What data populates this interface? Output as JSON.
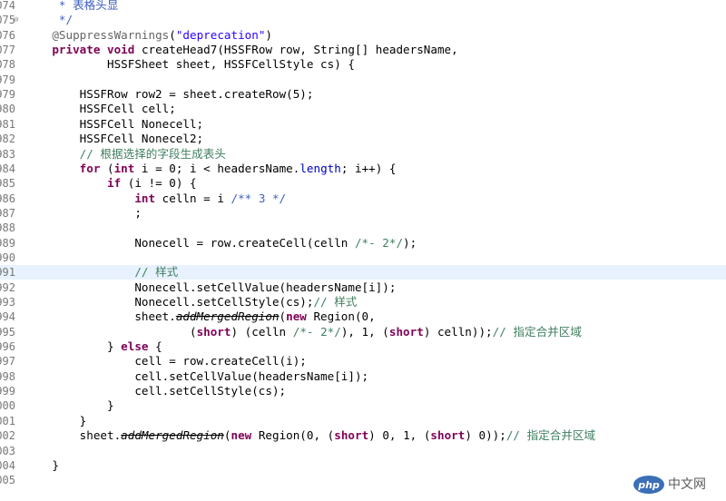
{
  "editor": {
    "current_line": "991",
    "lines": [
      {
        "num": "074",
        "tokens": [
          {
            "t": "     * ",
            "c": "jd"
          },
          {
            "t": "表格头显",
            "c": "jd"
          }
        ]
      },
      {
        "num": "075",
        "fold": "minus",
        "tokens": [
          {
            "t": "     */",
            "c": "jd"
          }
        ]
      },
      {
        "num": "076",
        "tokens": [
          {
            "t": "    ",
            "c": "plain"
          },
          {
            "t": "@SuppressWarnings",
            "c": "ann"
          },
          {
            "t": "(",
            "c": "plain"
          },
          {
            "t": "\"deprecation\"",
            "c": "str"
          },
          {
            "t": ")",
            "c": "plain"
          }
        ]
      },
      {
        "num": "077",
        "tokens": [
          {
            "t": "    ",
            "c": "plain"
          },
          {
            "t": "private",
            "c": "kw"
          },
          {
            "t": " ",
            "c": "plain"
          },
          {
            "t": "void",
            "c": "kw"
          },
          {
            "t": " createHead7(HSSFRow row, String[] headersName,",
            "c": "plain"
          }
        ]
      },
      {
        "num": "078",
        "tokens": [
          {
            "t": "            HSSFSheet sheet, HSSFCellStyle cs) {",
            "c": "plain"
          }
        ]
      },
      {
        "num": "979",
        "tokens": []
      },
      {
        "num": "979",
        "tokens": [
          {
            "t": "        HSSFRow row2 = sheet.createRow(5);",
            "c": "plain"
          }
        ]
      },
      {
        "num": "980",
        "tokens": [
          {
            "t": "        HSSFCell cell;",
            "c": "plain"
          }
        ]
      },
      {
        "num": "981",
        "tokens": [
          {
            "t": "        HSSFCell Nonecell;",
            "c": "plain"
          }
        ]
      },
      {
        "num": "982",
        "tokens": [
          {
            "t": "        HSSFCell Nonecel2;",
            "c": "plain"
          }
        ]
      },
      {
        "num": "983",
        "tokens": [
          {
            "t": "        ",
            "c": "plain"
          },
          {
            "t": "// 根据选择的字段生成表头",
            "c": "cm"
          }
        ]
      },
      {
        "num": "984",
        "tokens": [
          {
            "t": "        ",
            "c": "plain"
          },
          {
            "t": "for",
            "c": "kw"
          },
          {
            "t": " (",
            "c": "plain"
          },
          {
            "t": "int",
            "c": "kw"
          },
          {
            "t": " i = 0; i < headersName.",
            "c": "plain"
          },
          {
            "t": "length",
            "c": "fld"
          },
          {
            "t": "; i++) {",
            "c": "plain"
          }
        ]
      },
      {
        "num": "985",
        "tokens": [
          {
            "t": "            ",
            "c": "plain"
          },
          {
            "t": "if",
            "c": "kw"
          },
          {
            "t": " (i != 0) {",
            "c": "plain"
          }
        ]
      },
      {
        "num": "986",
        "tokens": [
          {
            "t": "                ",
            "c": "plain"
          },
          {
            "t": "int",
            "c": "kw"
          },
          {
            "t": " celln = i ",
            "c": "plain"
          },
          {
            "t": "/** 3 */",
            "c": "jd"
          }
        ]
      },
      {
        "num": "987",
        "tokens": [
          {
            "t": "                ;",
            "c": "plain"
          }
        ]
      },
      {
        "num": "988",
        "tokens": []
      },
      {
        "num": "989",
        "tokens": [
          {
            "t": "                Nonecell = row.createCell(celln ",
            "c": "plain"
          },
          {
            "t": "/*- 2*/",
            "c": "cm"
          },
          {
            "t": ");",
            "c": "plain"
          }
        ]
      },
      {
        "num": "990",
        "tokens": []
      },
      {
        "num": "991",
        "tokens": [
          {
            "t": "                ",
            "c": "plain"
          },
          {
            "t": "// 样式",
            "c": "cm"
          }
        ]
      },
      {
        "num": "992",
        "tokens": [
          {
            "t": "                Nonecell.setCellValue(headersName[i]);",
            "c": "plain"
          }
        ]
      },
      {
        "num": "993",
        "tokens": [
          {
            "t": "                Nonecell.setCellStyle(cs);",
            "c": "plain"
          },
          {
            "t": "// 样式",
            "c": "cm"
          }
        ]
      },
      {
        "num": "994",
        "tokens": [
          {
            "t": "                sheet.",
            "c": "plain"
          },
          {
            "t": "addMergedRegion",
            "c": "strike"
          },
          {
            "t": "(",
            "c": "plain"
          },
          {
            "t": "new",
            "c": "kw"
          },
          {
            "t": " Region(0,",
            "c": "plain"
          }
        ]
      },
      {
        "num": "995",
        "tokens": [
          {
            "t": "                        (",
            "c": "plain"
          },
          {
            "t": "short",
            "c": "kw"
          },
          {
            "t": ") (celln ",
            "c": "plain"
          },
          {
            "t": "/*- 2*/",
            "c": "cm"
          },
          {
            "t": "), 1, (",
            "c": "plain"
          },
          {
            "t": "short",
            "c": "kw"
          },
          {
            "t": ") celln));",
            "c": "plain"
          },
          {
            "t": "// 指定合并区域",
            "c": "cm"
          }
        ]
      },
      {
        "num": "996",
        "tokens": [
          {
            "t": "            } ",
            "c": "plain"
          },
          {
            "t": "else",
            "c": "kw"
          },
          {
            "t": " {",
            "c": "plain"
          }
        ]
      },
      {
        "num": "997",
        "tokens": [
          {
            "t": "                cell = row.createCell(i);",
            "c": "plain"
          }
        ]
      },
      {
        "num": "998",
        "tokens": [
          {
            "t": "                cell.setCellValue(headersName[i]);",
            "c": "plain"
          }
        ]
      },
      {
        "num": "999",
        "tokens": [
          {
            "t": "                cell.setCellStyle(cs);",
            "c": "plain"
          }
        ]
      },
      {
        "num": "000",
        "tokens": [
          {
            "t": "            }",
            "c": "plain"
          }
        ]
      },
      {
        "num": "001",
        "tokens": [
          {
            "t": "        }",
            "c": "plain"
          }
        ]
      },
      {
        "num": "002",
        "tokens": [
          {
            "t": "        sheet.",
            "c": "plain"
          },
          {
            "t": "addMergedRegion",
            "c": "strike"
          },
          {
            "t": "(",
            "c": "plain"
          },
          {
            "t": "new",
            "c": "kw"
          },
          {
            "t": " Region(0, (",
            "c": "plain"
          },
          {
            "t": "short",
            "c": "kw"
          },
          {
            "t": ") 0, 1, (",
            "c": "plain"
          },
          {
            "t": "short",
            "c": "kw"
          },
          {
            "t": ") 0));",
            "c": "plain"
          },
          {
            "t": "// 指定合并区域",
            "c": "cm"
          }
        ]
      },
      {
        "num": "003",
        "tokens": []
      },
      {
        "num": "004",
        "tokens": [
          {
            "t": "    }",
            "c": "plain"
          }
        ]
      },
      {
        "num": "005",
        "tokens": []
      }
    ]
  },
  "watermark": {
    "logo_text": "php",
    "site_text": "中文网"
  }
}
